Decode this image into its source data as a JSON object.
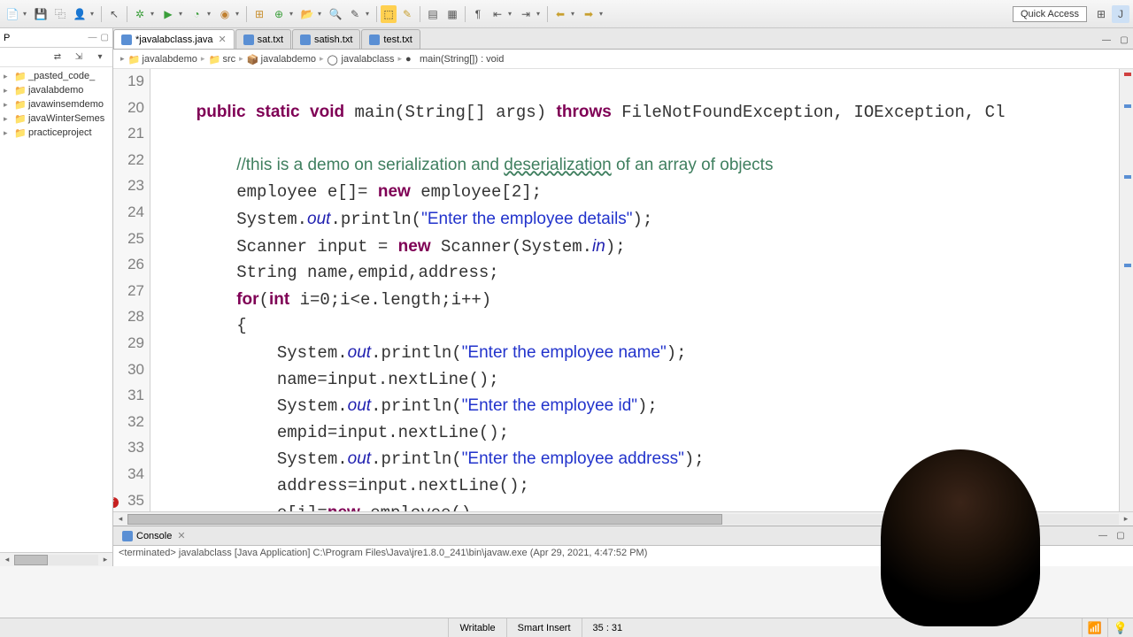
{
  "toolbar": {
    "quick_access": "Quick Access"
  },
  "explorer": {
    "view_label": "P",
    "projects": [
      "_pasted_code_",
      "javalabdemo",
      "javawinsemdemo",
      "javaWinterSemes",
      "practiceproject"
    ]
  },
  "tabs": [
    {
      "label": "*javalabclass.java",
      "active": true
    },
    {
      "label": "sat.txt",
      "active": false
    },
    {
      "label": "satish.txt",
      "active": false
    },
    {
      "label": "test.txt",
      "active": false
    }
  ],
  "breadcrumb": [
    "javalabdemo",
    "src",
    "javalabdemo",
    "javalabclass",
    "main(String[]) : void"
  ],
  "code_lines": [
    {
      "n": 19,
      "html": ""
    },
    {
      "n": 20,
      "html": "    <span class='kw'>public</span> <span class='kw'>static</span> <span class='kw'>void</span> main(String[] args) <span class='kw'>throws</span> FileNotFoundException, IOException, Cl"
    },
    {
      "n": 21,
      "html": ""
    },
    {
      "n": 22,
      "html": "        <span class='com'>//this is a demo on serialization and <span class='u'>deserialization</span> of an array of objects</span>"
    },
    {
      "n": 23,
      "html": "        employee e[]= <span class='kw'>new</span> employee[2];"
    },
    {
      "n": 24,
      "html": "        System.<span class='fld'>out</span>.println(<span class='str'>\"Enter the employee details\"</span>);"
    },
    {
      "n": 25,
      "html": "        Scanner input = <span class='kw'>new</span> Scanner(System.<span class='fld'>in</span>);"
    },
    {
      "n": 26,
      "html": "        String name,empid,address;"
    },
    {
      "n": 27,
      "html": "        <span class='kw'>for</span>(<span class='kw'>int</span> i=0;i&lt;e.length;i++)"
    },
    {
      "n": 28,
      "html": "        {"
    },
    {
      "n": 29,
      "html": "            System.<span class='fld'>out</span>.println(<span class='str'>\"Enter the employee name\"</span>);"
    },
    {
      "n": 30,
      "html": "            name=input.nextLine();"
    },
    {
      "n": 31,
      "html": "            System.<span class='fld'>out</span>.println(<span class='str'>\"Enter the employee id\"</span>);"
    },
    {
      "n": 32,
      "html": "            empid=input.nextLine();"
    },
    {
      "n": 33,
      "html": "            System.<span class='fld'>out</span>.println(<span class='str'>\"Enter the employee address\"</span>);"
    },
    {
      "n": 34,
      "html": "            address=input.nextLine();"
    },
    {
      "n": 35,
      "html": "            e[i]=<span class='kw'>new</span> employee()",
      "err": true
    }
  ],
  "console": {
    "tab": "Console",
    "text": "<terminated> javalabclass [Java Application] C:\\Program Files\\Java\\jre1.8.0_241\\bin\\javaw.exe (Apr 29, 2021, 4:47:52 PM)"
  },
  "status": {
    "writable": "Writable",
    "insert": "Smart Insert",
    "pos": "35 : 31"
  }
}
